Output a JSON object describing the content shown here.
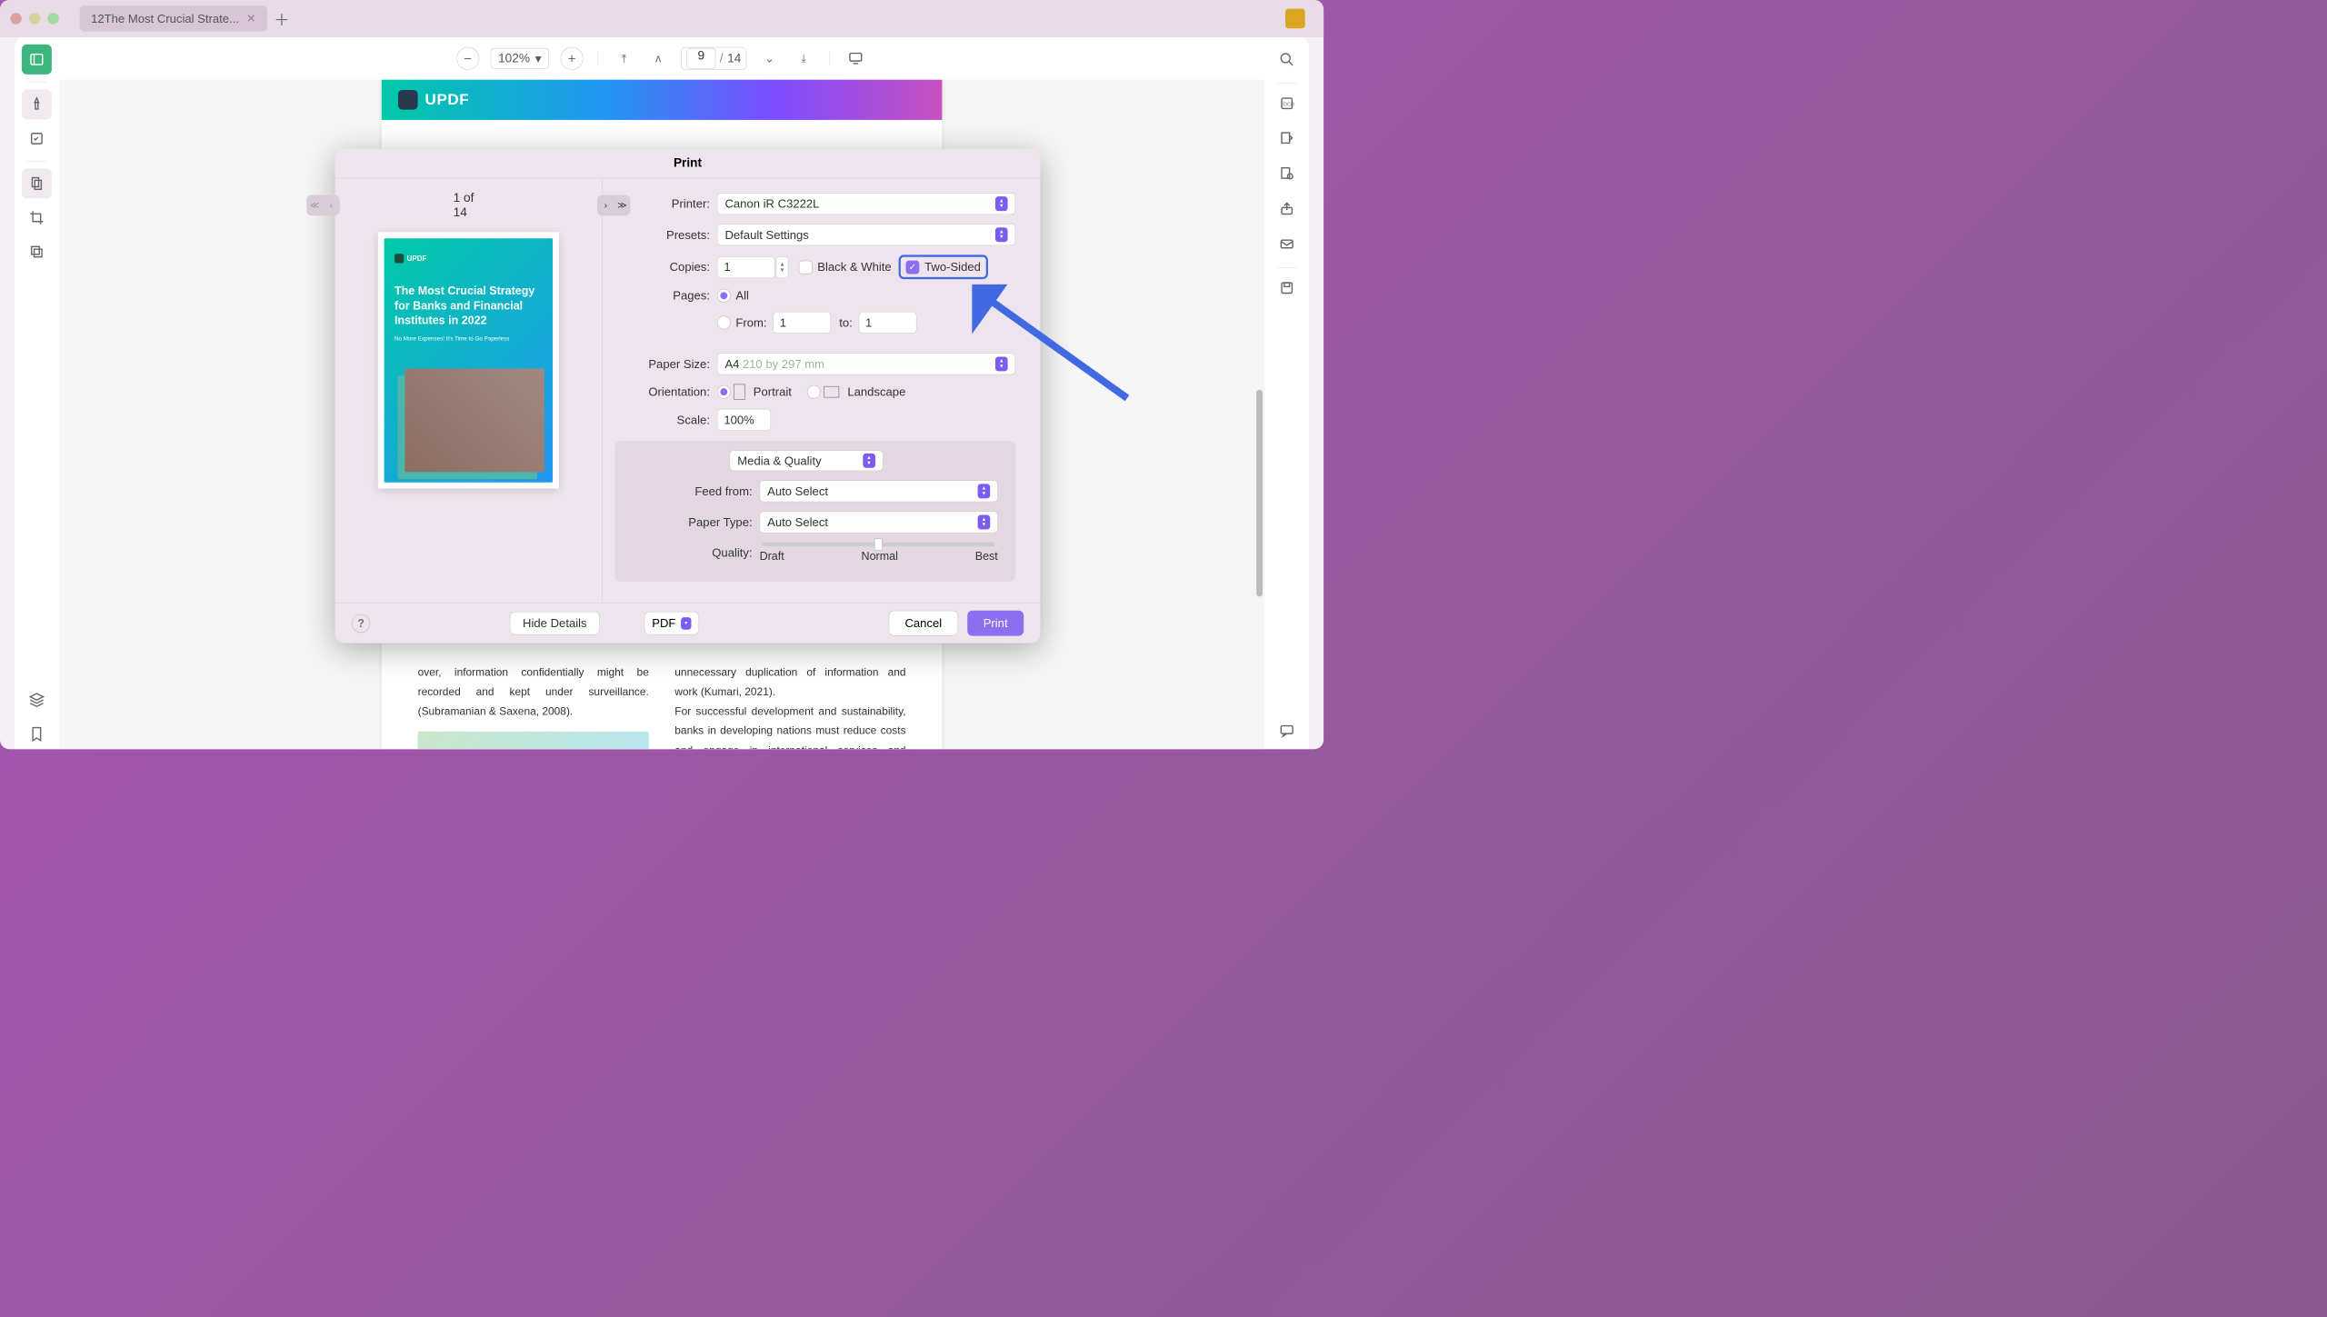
{
  "titlebar": {
    "tab_name": "12The Most Crucial Strate..."
  },
  "toolbar": {
    "zoom": "102%",
    "current_page": "9",
    "total_pages": "14"
  },
  "doc": {
    "brand": "UPDF",
    "col1_text1": "over, information confidentially might be recorded and kept under surveillance. (Subramanian & Saxena, 2008).",
    "col2_text1": "unnecessary duplication of information and work (Kumari, 2021).",
    "col2_text2": "For successful development and sustainability, banks in developing nations must reduce costs and engage in international services and markets."
  },
  "print": {
    "title": "Print",
    "preview_page": "1 of 14",
    "thumb_brand": "UPDF",
    "thumb_title": "The Most Crucial Strategy for Banks and Financial Institutes in 2022",
    "thumb_sub": "No More Expenses! It's Time to Go Paperless",
    "printer_label": "Printer:",
    "printer_value": "Canon iR C3222L",
    "presets_label": "Presets:",
    "presets_value": "Default Settings",
    "copies_label": "Copies:",
    "copies_value": "1",
    "bw_label": "Black & White",
    "twosided_label": "Two-Sided",
    "pages_label": "Pages:",
    "pages_all": "All",
    "pages_from": "From:",
    "pages_from_val": "1",
    "pages_to": "to:",
    "pages_to_val": "1",
    "papersize_label": "Paper Size:",
    "papersize_value": "A4",
    "papersize_dim": "210 by 297 mm",
    "orientation_label": "Orientation:",
    "portrait": "Portrait",
    "landscape": "Landscape",
    "scale_label": "Scale:",
    "scale_value": "100%",
    "section_media": "Media & Quality",
    "feed_label": "Feed from:",
    "feed_value": "Auto Select",
    "papertype_label": "Paper Type:",
    "papertype_value": "Auto Select",
    "quality_label": "Quality:",
    "q_draft": "Draft",
    "q_normal": "Normal",
    "q_best": "Best",
    "hide_details": "Hide Details",
    "pdf": "PDF",
    "cancel": "Cancel",
    "print_btn": "Print"
  }
}
